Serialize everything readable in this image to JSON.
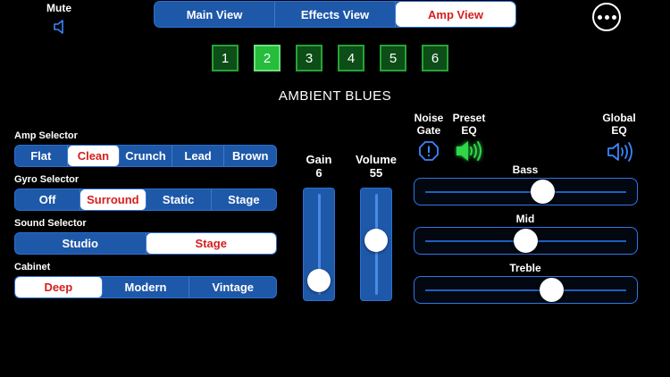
{
  "mute": {
    "label": "Mute",
    "icon": "speaker-muted-icon"
  },
  "views": [
    {
      "label": "Main View",
      "active": false
    },
    {
      "label": "Effects View",
      "active": false
    },
    {
      "label": "Amp View",
      "active": true
    }
  ],
  "more_icon": "more-horizontal-icon",
  "presets": [
    {
      "label": "1",
      "active": false
    },
    {
      "label": "2",
      "active": true
    },
    {
      "label": "3",
      "active": false
    },
    {
      "label": "4",
      "active": false
    },
    {
      "label": "5",
      "active": false
    },
    {
      "label": "6",
      "active": false
    }
  ],
  "preset_name": "AMBIENT BLUES",
  "amp_selector": {
    "label": "Amp Selector",
    "options": [
      "Flat",
      "Clean",
      "Crunch",
      "Lead",
      "Brown"
    ],
    "selected": "Clean"
  },
  "gyro_selector": {
    "label": "Gyro Selector",
    "options": [
      "Off",
      "Surround",
      "Static",
      "Stage"
    ],
    "selected": "Surround"
  },
  "sound_selector": {
    "label": "Sound Selector",
    "options": [
      "Studio",
      "Stage"
    ],
    "selected": "Stage"
  },
  "cabinet": {
    "label": "Cabinet",
    "options": [
      "Deep",
      "Modern",
      "Vintage"
    ],
    "selected": "Deep"
  },
  "gain": {
    "label": "Gain",
    "value": "6",
    "level": 0.06
  },
  "volume": {
    "label": "Volume",
    "value": "55",
    "level": 0.55
  },
  "noise_gate": {
    "label_line1": "Noise",
    "label_line2": "Gate",
    "icon": "alert-octagon-icon"
  },
  "preset_eq": {
    "label_line1": "Preset",
    "label_line2": "EQ",
    "icon": "speaker-wave-icon",
    "color": "#2fd84a"
  },
  "global_eq": {
    "label_line1": "Global",
    "label_line2": "EQ",
    "icon": "speaker-wave-icon",
    "color": "#3a86ff"
  },
  "eq": {
    "bass": {
      "label": "Bass",
      "level": 0.59
    },
    "mid": {
      "label": "Mid",
      "level": 0.5
    },
    "treble": {
      "label": "Treble",
      "level": 0.64
    }
  },
  "colors": {
    "accent_blue": "#1e58a8",
    "active_red": "#d61e1e",
    "preset_green": "#25bd3b"
  }
}
